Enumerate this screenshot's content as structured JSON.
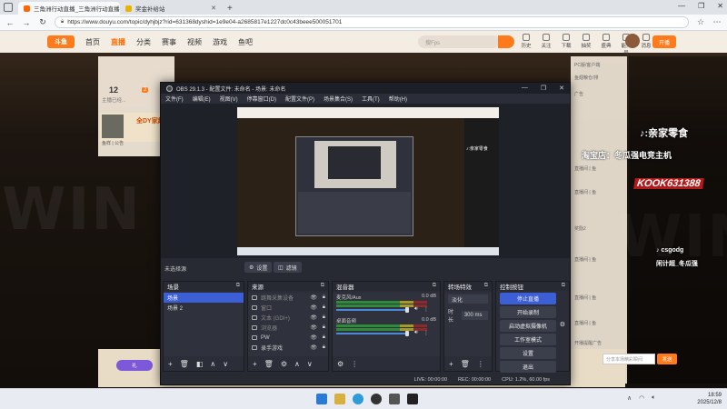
{
  "browser": {
    "tabs": [
      {
        "title": "三角洲行动直播_三角洲行动直播视",
        "active": true
      },
      {
        "title": "奖金补给站",
        "active": false
      }
    ],
    "url": "https://www.douyu.com/topic/dyhjbjz?rid=631368dyshid=1e9e04-a2685817e1227dc0c43beee500051701"
  },
  "site": {
    "logo": "斗鱼",
    "nav": [
      "首页",
      "直播",
      "分类",
      "赛事",
      "视频",
      "游戏",
      "鱼吧"
    ],
    "active_nav": "直播",
    "search_placeholder": "搜Fps",
    "header_icons": [
      "历史",
      "关注",
      "下载",
      "抽奖",
      "盛典",
      "能升号",
      "消息"
    ],
    "live_button": "开播",
    "left_num": "12",
    "left_small": "主播已经...",
    "left_badge_count": "2",
    "left_card_text": "全DY家超",
    "left_card_sub": "鱼样 | 公告",
    "bg_text": "WIN",
    "right_overlay": {
      "line1": "♪:亲家零食",
      "line2": "淘宝店：冬瓜强电竞主机",
      "kook": "KOOK631388",
      "line3": "♪ csgodg",
      "line4": "闲计超_冬瓜强"
    },
    "right_lines": [
      "PC版/客户端",
      "鱼翅粮仓/排",
      "广告",
      "直播间 | 鱼",
      "直播间 | 鱼",
      "奖励2",
      "直播间 | 鱼",
      "直播间 | 鱼",
      "直播间 | 鱼",
      "开播提醒广告"
    ],
    "footer_input_placeholder": "分享本场精彩瞬间",
    "footer_send": "发送",
    "footer_buttons": [
      "礼",
      "收礼",
      "鱼丸"
    ]
  },
  "obs": {
    "title": "OBS 29.1.3 - 配置文件: 未命名 - 场景: 未命名",
    "menu": [
      "文件(F)",
      "编辑(E)",
      "视图(V)",
      "停靠窗口(D)",
      "配置文件(P)",
      "场景集合(S)",
      "工具(T)",
      "帮助(H)"
    ],
    "no_source": "未选择源",
    "settings_btn": "设置",
    "filters_btn": "滤镜",
    "scenes": {
      "title": "场景",
      "items": [
        "场景",
        "场景 2"
      ],
      "selected": 0
    },
    "sources": {
      "title": "来源",
      "items": [
        "跳舞采集设备",
        "窗口",
        "文本 (GDI+)",
        "浏览器",
        "PW",
        "录手游戏"
      ]
    },
    "mixer": {
      "title": "混音器",
      "channels": [
        {
          "name": "麦克风/Aux",
          "db": "0.0 dB"
        },
        {
          "name": "桌面音频",
          "db": "0.0 dB"
        }
      ]
    },
    "transitions": {
      "title": "转场特效",
      "type": "淡化",
      "duration_label": "时长",
      "duration": "300 ms"
    },
    "controls": {
      "title": "控制按钮",
      "buttons": [
        "停止直播",
        "开始录制",
        "启动虚拟摄像机",
        "工作室模式",
        "设置",
        "退出"
      ]
    },
    "status": {
      "live": "LIVE: 00:00:00",
      "rec": "REC: 00:00:00",
      "cpu": "CPU: 1.2%, 60.00 fps"
    }
  },
  "taskbar": {
    "time": "18:59",
    "date": "2025/12/8",
    "tray_icons": [
      "chevron-up",
      "wifi",
      "volume"
    ]
  },
  "colors": {
    "accent": "#ff7a1a",
    "obs_bg": "#272a33",
    "obs_select": "#3c5fd6"
  }
}
